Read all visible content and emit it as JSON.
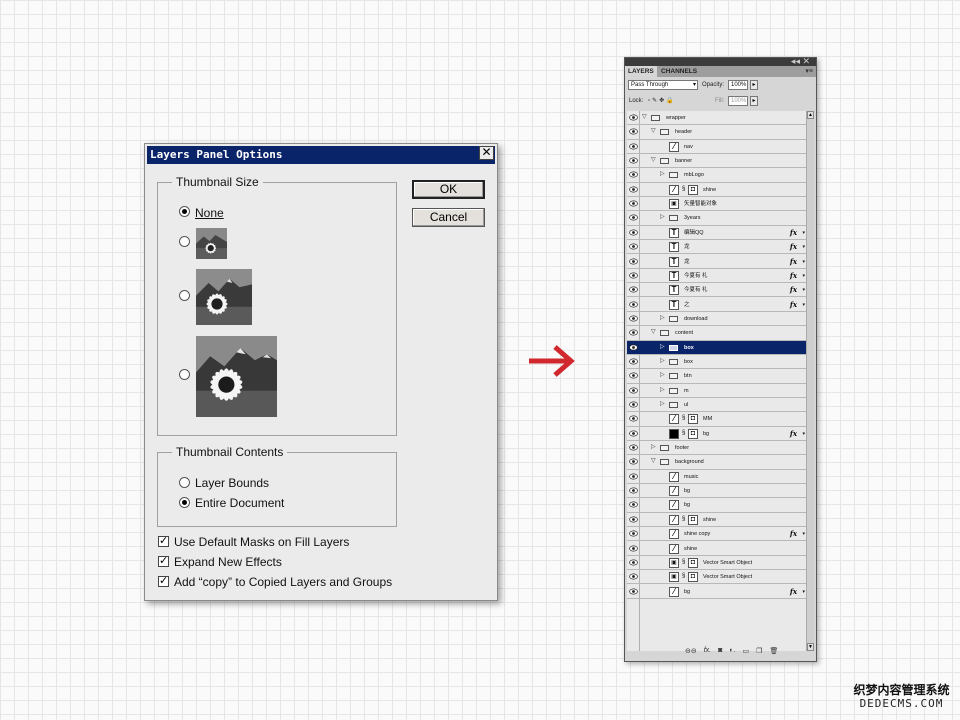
{
  "dialog": {
    "title": "Layers Panel Options",
    "close_glyph": "✕",
    "ok_label": "OK",
    "cancel_label": "Cancel",
    "thumbnail_size": {
      "title": "Thumbnail Size",
      "none_label": "None",
      "selected": "None"
    },
    "thumbnail_contents": {
      "title": "Thumbnail Contents",
      "options": [
        "Layer Bounds",
        "Entire Document"
      ],
      "selected": "Entire Document"
    },
    "checkboxes": [
      {
        "label": "Use Default Masks on Fill Layers",
        "checked": true
      },
      {
        "label": "Expand New Effects",
        "checked": true
      },
      {
        "label": "Add “copy” to Copied Layers and Groups",
        "checked": true
      }
    ]
  },
  "panel": {
    "tabs": [
      "LAYERS",
      "CHANNELS"
    ],
    "blend_mode": "Pass Through",
    "opacity_label": "Opacity:",
    "opacity_value": "100%",
    "lock_label": "Lock:",
    "fill_label": "Fill:",
    "fill_value": "100%",
    "selected_layer": "box",
    "layers": [
      {
        "name": "wrapper",
        "kind": "group",
        "expanded": true,
        "indent": 0
      },
      {
        "name": "header",
        "kind": "group",
        "expanded": true,
        "indent": 1
      },
      {
        "name": "nav",
        "kind": "brush",
        "indent": 2
      },
      {
        "name": "banner",
        "kind": "group",
        "expanded": true,
        "indent": 1
      },
      {
        "name": "mbLogo",
        "kind": "group",
        "expanded": false,
        "indent": 2
      },
      {
        "name": "shine",
        "kind": "masked",
        "indent": 2
      },
      {
        "name": "矢量智能对象",
        "kind": "smart",
        "indent": 2
      },
      {
        "name": "3years",
        "kind": "group",
        "expanded": false,
        "indent": 2
      },
      {
        "name": "编辑QQ",
        "kind": "text",
        "indent": 2,
        "fx": true
      },
      {
        "name": "龙",
        "kind": "text",
        "indent": 2,
        "fx": true
      },
      {
        "name": "龙",
        "kind": "text",
        "indent": 2,
        "fx": true
      },
      {
        "name": "今夏有 礼",
        "kind": "text",
        "indent": 2,
        "fx": true
      },
      {
        "name": "今夏有 礼",
        "kind": "text",
        "indent": 2,
        "fx": true
      },
      {
        "name": "之",
        "kind": "text",
        "indent": 2,
        "fx": true
      },
      {
        "name": "download",
        "kind": "group",
        "expanded": false,
        "indent": 2
      },
      {
        "name": "content",
        "kind": "group",
        "expanded": true,
        "indent": 1
      },
      {
        "name": "box",
        "kind": "group",
        "expanded": false,
        "indent": 2
      },
      {
        "name": "box",
        "kind": "group",
        "expanded": false,
        "indent": 2
      },
      {
        "name": "btn",
        "kind": "group",
        "expanded": false,
        "indent": 2
      },
      {
        "name": "m",
        "kind": "group",
        "expanded": false,
        "indent": 2
      },
      {
        "name": "ul",
        "kind": "group",
        "expanded": false,
        "indent": 2
      },
      {
        "name": "MM",
        "kind": "masked",
        "indent": 2
      },
      {
        "name": "bg",
        "kind": "black-masked",
        "indent": 2,
        "fx": true
      },
      {
        "name": "footer",
        "kind": "group",
        "expanded": false,
        "indent": 1
      },
      {
        "name": "background",
        "kind": "group",
        "expanded": true,
        "indent": 1
      },
      {
        "name": "music",
        "kind": "brush",
        "indent": 2
      },
      {
        "name": "bg",
        "kind": "brush",
        "indent": 2
      },
      {
        "name": "bg",
        "kind": "brush",
        "indent": 2
      },
      {
        "name": "shine",
        "kind": "masked",
        "indent": 2
      },
      {
        "name": "shine copy",
        "kind": "brush",
        "indent": 2,
        "fx": true
      },
      {
        "name": "shine",
        "kind": "brush",
        "indent": 2
      },
      {
        "name": "Vector Smart Object",
        "kind": "smart-masked",
        "indent": 2
      },
      {
        "name": "Vector Smart Object",
        "kind": "smart-masked",
        "indent": 2
      },
      {
        "name": "bg",
        "kind": "brush",
        "indent": 2,
        "fx": true
      }
    ],
    "footer_icons": [
      "link-icon",
      "fx-icon",
      "mask-icon",
      "adjustment-icon",
      "folder-icon",
      "new-layer-icon",
      "trash-icon"
    ]
  },
  "watermark": {
    "line1": "织梦内容管理系统",
    "line2": "DEDECMS.COM"
  },
  "colors": {
    "title_bar": "#0a246a",
    "arrow": "#d0282c",
    "selected_row": "#0a246a"
  }
}
